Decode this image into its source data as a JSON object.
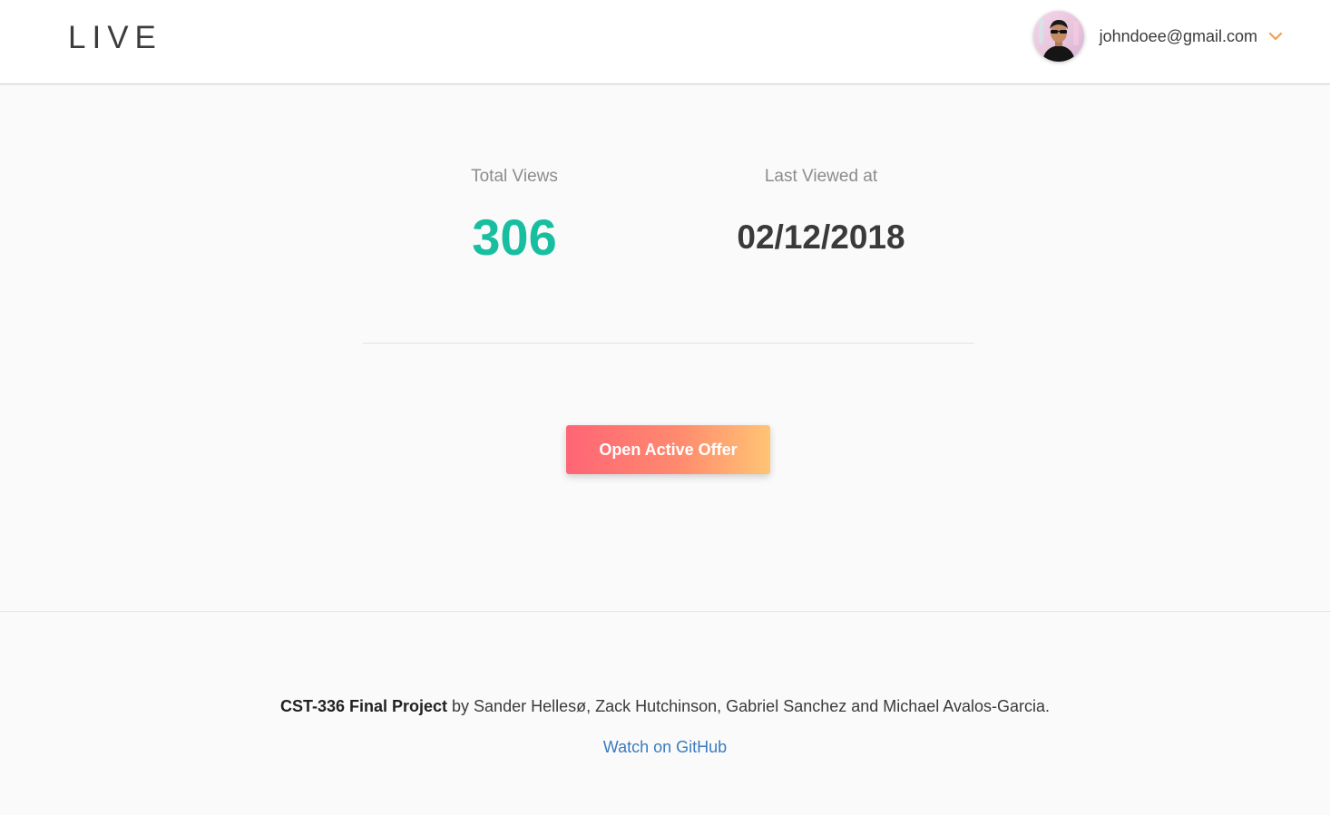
{
  "header": {
    "logo": "LIVE",
    "user_email": "johndoee@gmail.com",
    "accent_color": "#f0a050"
  },
  "stats": {
    "total_views_label": "Total Views",
    "total_views_value": "306",
    "last_viewed_label": "Last Viewed at",
    "last_viewed_value": "02/12/2018"
  },
  "actions": {
    "open_offer_label": "Open Active Offer"
  },
  "footer": {
    "project_name": "CST-336 Final Project",
    "credits_text": " by Sander Hellesø, Zack Hutchinson, Gabriel Sanchez and Michael Avalos-Garcia.",
    "github_link": "Watch on GitHub"
  },
  "colors": {
    "views_value": "#17bfa0",
    "button_gradient_start": "#ff6575",
    "button_gradient_end": "#ffc474",
    "link": "#3b7bbf"
  }
}
